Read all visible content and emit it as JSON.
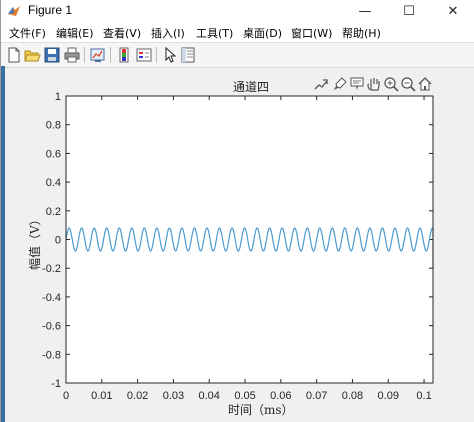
{
  "window": {
    "title": "Figure 1",
    "minimize_glyph": "—",
    "maximize_glyph": "☐",
    "close_glyph": "✕"
  },
  "menu": {
    "items": [
      "文件(F)",
      "编辑(E)",
      "查看(V)",
      "插入(I)",
      "工具(T)",
      "桌面(D)",
      "窗口(W)",
      "帮助(H)"
    ]
  },
  "toolbar": {
    "buttons": [
      "new-figure-icon",
      "open-file-icon",
      "save-icon",
      "print-icon",
      "link-plot-icon",
      "insert-colorbar-icon",
      "insert-legend-icon",
      "edit-plot-arrow-icon",
      "property-inspector-icon"
    ]
  },
  "axes_toolbar": {
    "buttons": [
      "export-icon",
      "brush-icon",
      "data-tips-icon",
      "pan-hand-icon",
      "zoom-in-icon",
      "zoom-out-icon",
      "home-icon"
    ]
  },
  "chart_data": {
    "type": "line",
    "title": "通道四",
    "xlabel": "时间（ms）",
    "ylabel": "幅值（V）",
    "xlim": [
      0,
      0.1025
    ],
    "ylim": [
      -1,
      1
    ],
    "xticks": [
      "0",
      "0.01",
      "0.02",
      "0.03",
      "0.04",
      "0.05",
      "0.06",
      "0.07",
      "0.08",
      "0.09",
      "0.1"
    ],
    "yticks": [
      "1",
      "0.8",
      "0.6",
      "0.4",
      "0.2",
      "0",
      "-0.2",
      "-0.4",
      "-0.6",
      "-0.8",
      "-1"
    ],
    "grid": false,
    "series": [
      {
        "color": "#4a9bd0",
        "signal": "sine",
        "amplitude": 0.08,
        "period_ms": 0.0035,
        "x_start": 0,
        "x_end": 0.1025
      }
    ]
  }
}
